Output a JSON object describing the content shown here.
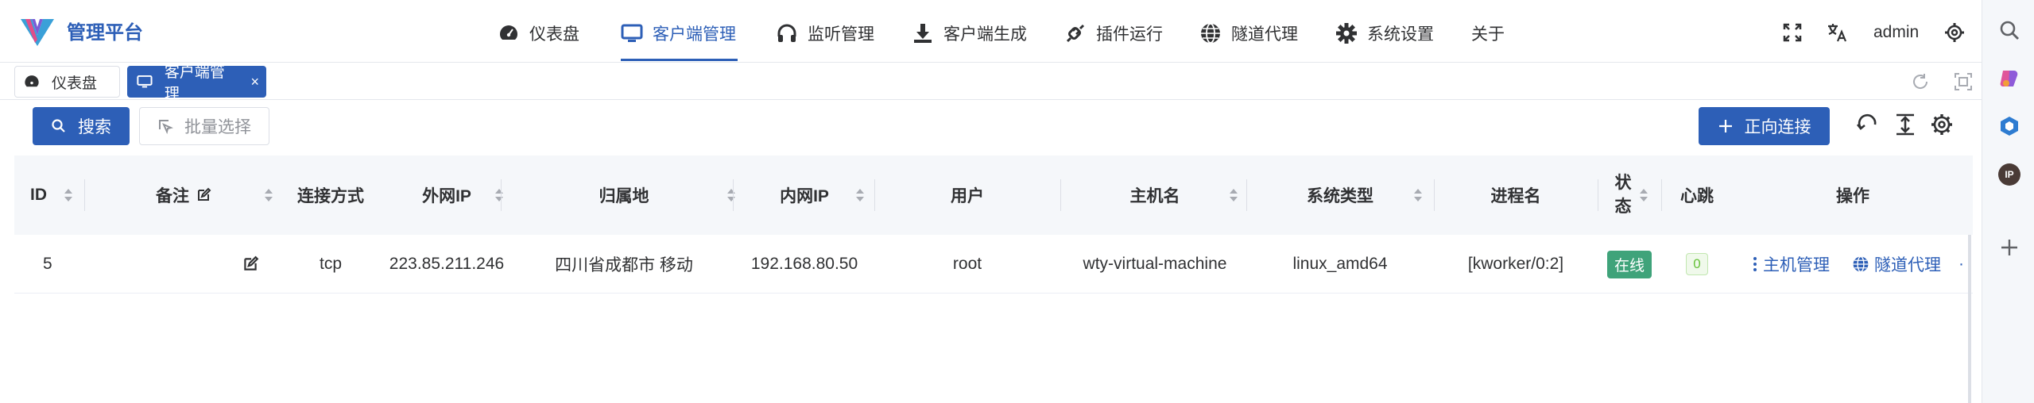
{
  "header": {
    "brand": "管理平台",
    "nav": [
      {
        "label": "仪表盘",
        "icon": "dashboard-icon"
      },
      {
        "label": "客户端管理",
        "icon": "monitor-icon",
        "active": true
      },
      {
        "label": "监听管理",
        "icon": "headphones-icon"
      },
      {
        "label": "客户端生成",
        "icon": "download-icon"
      },
      {
        "label": "插件运行",
        "icon": "plug-icon"
      },
      {
        "label": "隧道代理",
        "icon": "globe-icon"
      },
      {
        "label": "系统设置",
        "icon": "gear-icon"
      },
      {
        "label": "关于",
        "icon": ""
      }
    ],
    "user": "admin"
  },
  "tabs": [
    {
      "label": "仪表盘",
      "icon": "dashboard-icon",
      "active": false
    },
    {
      "label": "客户端管理",
      "icon": "monitor-icon",
      "active": true,
      "close": "×"
    }
  ],
  "toolbar": {
    "search_label": "搜索",
    "batch_label": "批量选择",
    "connect_label": "正向连接"
  },
  "table": {
    "columns": [
      "ID",
      "备注",
      "连接方式",
      "外网IP",
      "归属地",
      "内网IP",
      "用户",
      "主机名",
      "系统类型",
      "进程名",
      "状态",
      "心跳",
      "操作"
    ],
    "rows": [
      {
        "id": "5",
        "remark": "",
        "conn": "tcp",
        "wan_ip": "223.85.211.246",
        "location": "四川省成都市 移动",
        "lan_ip": "192.168.80.50",
        "user": "root",
        "host": "wty-virtual-machine",
        "os": "linux_amd64",
        "process": "[kworker/0:2]",
        "status": "在线",
        "heartbeat": "0",
        "op_host": "主机管理",
        "op_tunnel": "隧道代理"
      }
    ]
  },
  "colors": {
    "accent": "#2d5fb7",
    "online": "#3fa37a",
    "heartbeat": "#67c23a"
  },
  "sidebar_right": {
    "ip_badge": "IP"
  }
}
